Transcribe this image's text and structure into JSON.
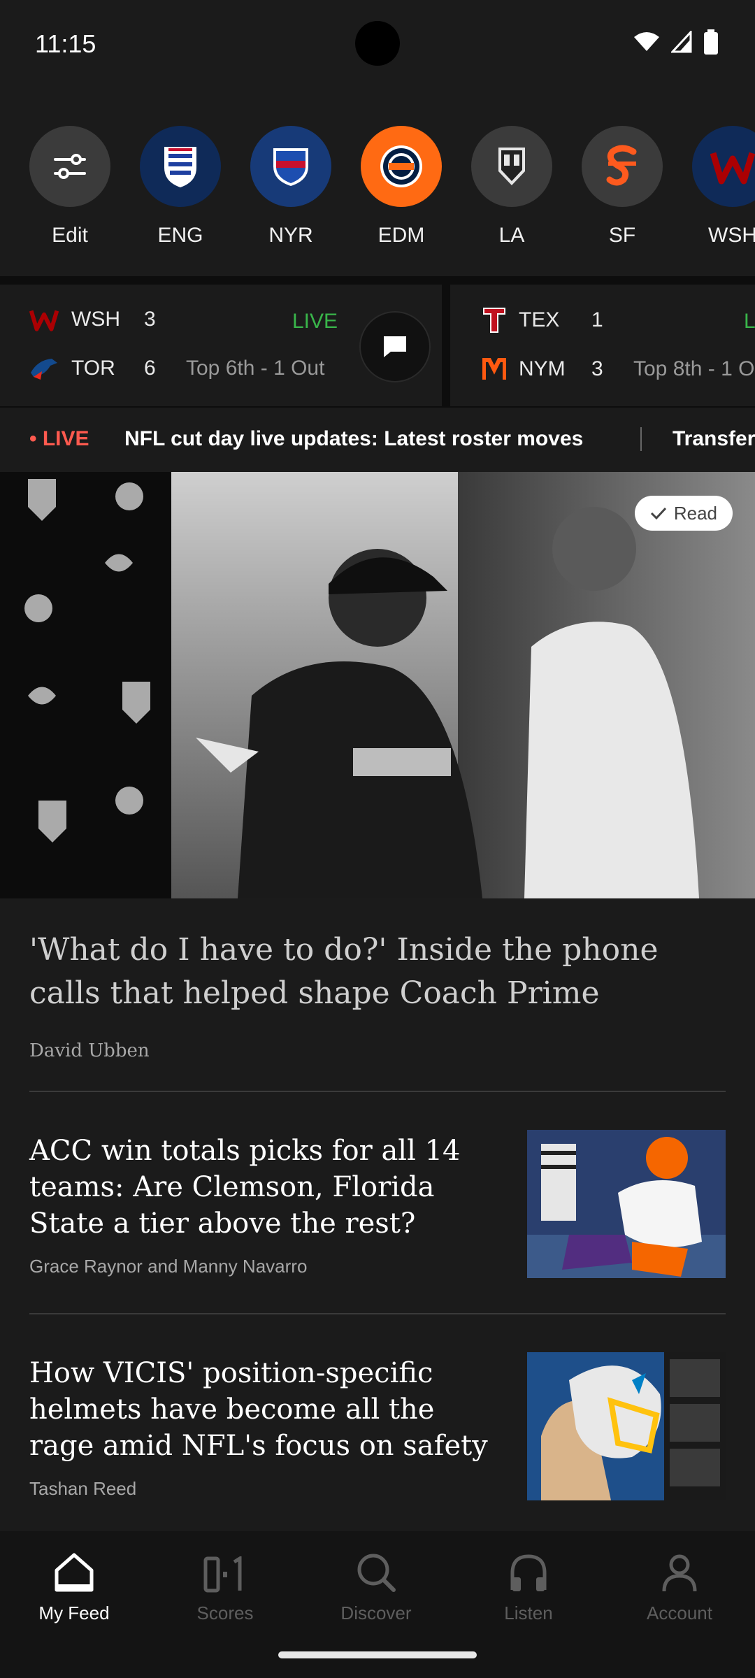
{
  "status_bar": {
    "time": "11:15"
  },
  "teams": [
    {
      "label": "Edit",
      "icon": "sliders-icon",
      "color": "#3b3b3b"
    },
    {
      "label": "ENG",
      "icon": "three-lions-crest-icon",
      "color": "#0f2a58"
    },
    {
      "label": "NYR",
      "icon": "rangers-shield-icon",
      "color": "#173a78"
    },
    {
      "label": "EDM",
      "icon": "oilers-logo-icon",
      "color": "#ff6a13"
    },
    {
      "label": "LA",
      "icon": "la-kings-logo-icon",
      "color": "#3b3b3b"
    },
    {
      "label": "SF",
      "icon": "giants-logo-icon",
      "color": "#3b3b3b"
    },
    {
      "label": "WSH",
      "icon": "nationals-logo-icon",
      "color": "#0f2a58"
    }
  ],
  "scores": [
    {
      "away": {
        "abbr": "WSH",
        "score": "3"
      },
      "home": {
        "abbr": "TOR",
        "score": "6"
      },
      "live": "LIVE",
      "status": "Top 6th - 1 Out"
    },
    {
      "away": {
        "abbr": "TEX",
        "score": "1"
      },
      "home": {
        "abbr": "NYM",
        "score": "3"
      },
      "live": "L",
      "status": "Top 8th - 1 O"
    }
  ],
  "ticker": {
    "live": "• LIVE",
    "headline": "NFL cut day live updates: Latest roster moves",
    "headline2": "Transfer"
  },
  "hero": {
    "badge": "Read",
    "title": "'What do I have to do?' Inside the phone calls that helped shape Coach Prime",
    "author": "David Ubben"
  },
  "stories": [
    {
      "title": "ACC win totals picks for all 14 teams: Are Clemson, Florida State a tier above the rest?",
      "author": "Grace Raynor and Manny Navarro"
    },
    {
      "title": "How VICIS' position-specific helmets have become all the rage amid NFL's focus on safety",
      "author": "Tashan Reed"
    }
  ],
  "nav": [
    {
      "label": "My Feed",
      "icon": "home-icon",
      "active": true
    },
    {
      "label": "Scores",
      "icon": "scoreboard-icon",
      "active": false
    },
    {
      "label": "Discover",
      "icon": "search-icon",
      "active": false
    },
    {
      "label": "Listen",
      "icon": "headphones-icon",
      "active": false
    },
    {
      "label": "Account",
      "icon": "person-icon",
      "active": false
    }
  ],
  "colors": {
    "live_green": "#39b54a",
    "live_red": "#ff5a4f",
    "background": "#1b1b1b"
  }
}
